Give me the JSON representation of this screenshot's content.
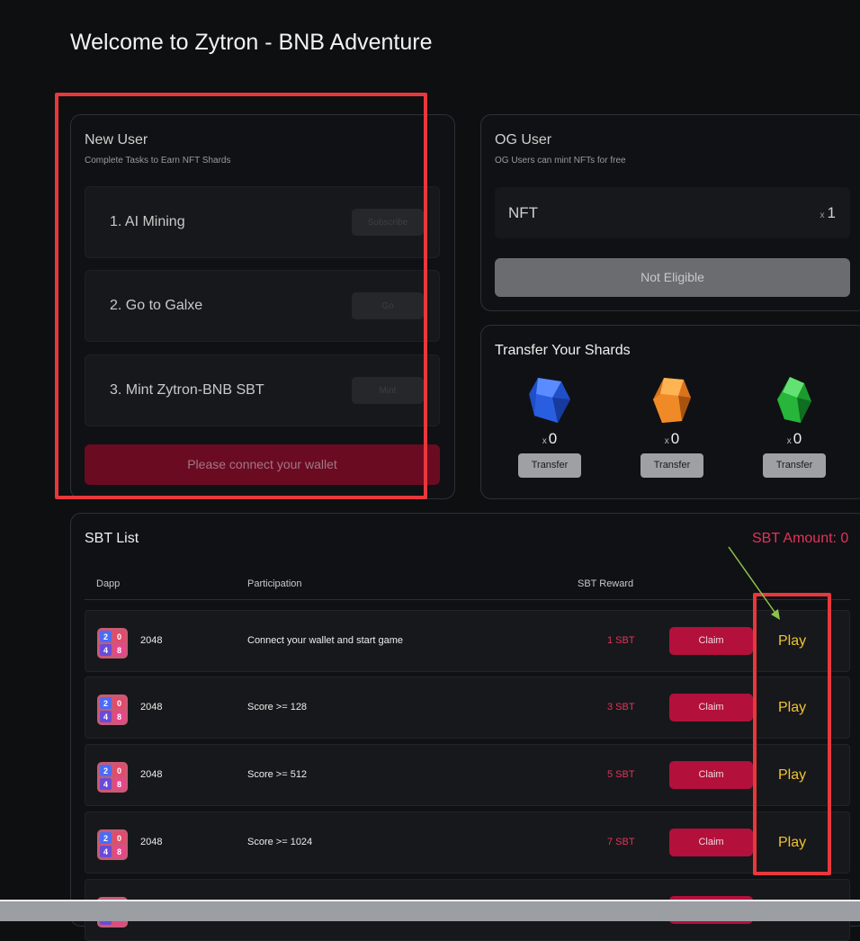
{
  "page": {
    "title": "Welcome to Zytron - BNB Adventure"
  },
  "new_user": {
    "title": "New User",
    "subtitle": "Complete Tasks to Earn NFT Shards",
    "tasks": [
      {
        "label": "1. AI Mining",
        "button": "Subscribe"
      },
      {
        "label": "2. Go to Galxe",
        "button": "Go"
      },
      {
        "label": "3. Mint Zytron-BNB SBT",
        "button": "Mint"
      }
    ],
    "connect_button": "Please connect your wallet"
  },
  "og_user": {
    "title": "OG User",
    "subtitle": "OG Users can mint NFTs for free",
    "nft_label": "NFT",
    "nft_multiplier": "x",
    "nft_count": "1",
    "eligibility_button": "Not Eligible"
  },
  "shards": {
    "title": "Transfer Your Shards",
    "items": [
      {
        "icon": "blue-shard-icon",
        "color": "#2e63e6",
        "multiplier": "x",
        "count": "0",
        "button": "Transfer"
      },
      {
        "icon": "orange-shard-icon",
        "color": "#f0902a",
        "multiplier": "x",
        "count": "0",
        "button": "Transfer"
      },
      {
        "icon": "green-shard-icon",
        "color": "#27b53a",
        "multiplier": "x",
        "count": "0",
        "button": "Transfer"
      }
    ]
  },
  "sbt_list": {
    "title": "SBT List",
    "amount_label": "SBT Amount: 0",
    "columns": [
      "Dapp",
      "Participation",
      "SBT Reward"
    ],
    "icon_tiles": [
      "2",
      "0",
      "4",
      "8"
    ],
    "rows": [
      {
        "dapp": "2048",
        "task": "Connect your wallet and start game",
        "reward": "1 SBT",
        "claim": "Claim",
        "action": "Play"
      },
      {
        "dapp": "2048",
        "task": "Score >= 128",
        "reward": "3 SBT",
        "claim": "Claim",
        "action": "Play"
      },
      {
        "dapp": "2048",
        "task": "Score >= 512",
        "reward": "5 SBT",
        "claim": "Claim",
        "action": "Play"
      },
      {
        "dapp": "2048",
        "task": "Score >= 1024",
        "reward": "7 SBT",
        "claim": "Claim",
        "action": "Play"
      }
    ]
  },
  "colors": {
    "accent_pink": "#e3325c",
    "claim_button": "#b3103c",
    "play_text": "#f1c232",
    "annotation_red": "#e8383c",
    "annotation_arrow": "#8bc34a"
  }
}
